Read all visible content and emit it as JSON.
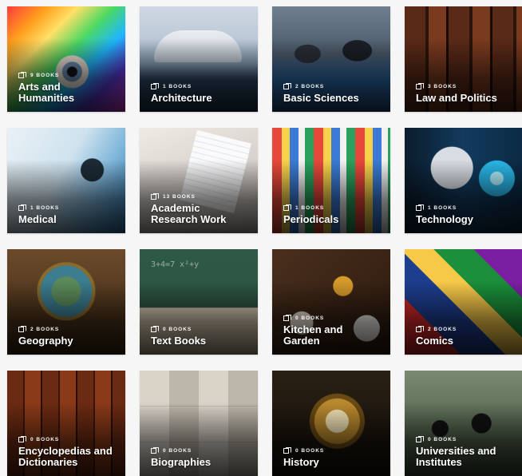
{
  "categories": [
    {
      "name": "Arts and\nHumanities",
      "count": "9 BOOKS",
      "image_icon": "rainbow-face-eye"
    },
    {
      "name": "Architecture",
      "count": "1 BOOKS",
      "image_icon": "modern-building-water"
    },
    {
      "name": "Basic Sciences",
      "count": "2 BOOKS",
      "image_icon": "lab-goggles-scientists"
    },
    {
      "name": "Law and Politics",
      "count": "3 BOOKS",
      "image_icon": "law-cases-books"
    },
    {
      "name": "Medical",
      "count": "1 BOOKS",
      "image_icon": "microscope-lab"
    },
    {
      "name": "Academic\nResearch Work",
      "count": "13 BOOKS",
      "image_icon": "desk-notebook-laptop"
    },
    {
      "name": "Periodicals",
      "count": "1 BOOKS",
      "image_icon": "magazine-stand"
    },
    {
      "name": "Technology",
      "count": "1 BOOKS",
      "image_icon": "robot-face"
    },
    {
      "name": "Geography",
      "count": "2 BOOKS",
      "image_icon": "globe"
    },
    {
      "name": "Text Books",
      "count": "0 BOOKS",
      "image_icon": "chalkboard-books"
    },
    {
      "name": "Kitchen and\nGarden",
      "count": "0 BOOKS",
      "image_icon": "food-table"
    },
    {
      "name": "Comics",
      "count": "2 BOOKS",
      "image_icon": "comic-covers"
    },
    {
      "name": "Encyclopedias and\nDictionaries",
      "count": "0 BOOKS",
      "image_icon": "old-leather-books"
    },
    {
      "name": "Biographies",
      "count": "0 BOOKS",
      "image_icon": "portrait-collage"
    },
    {
      "name": "History",
      "count": "0 BOOKS",
      "image_icon": "astronomical-clock"
    },
    {
      "name": "Universities and\nInstitutes",
      "count": "0 BOOKS",
      "image_icon": "graduation-caps"
    }
  ],
  "icons": {
    "book_count_icon": "books-icon"
  },
  "colors": {
    "label_text": "#ffffff",
    "page_bg": "#f6f6f6"
  }
}
